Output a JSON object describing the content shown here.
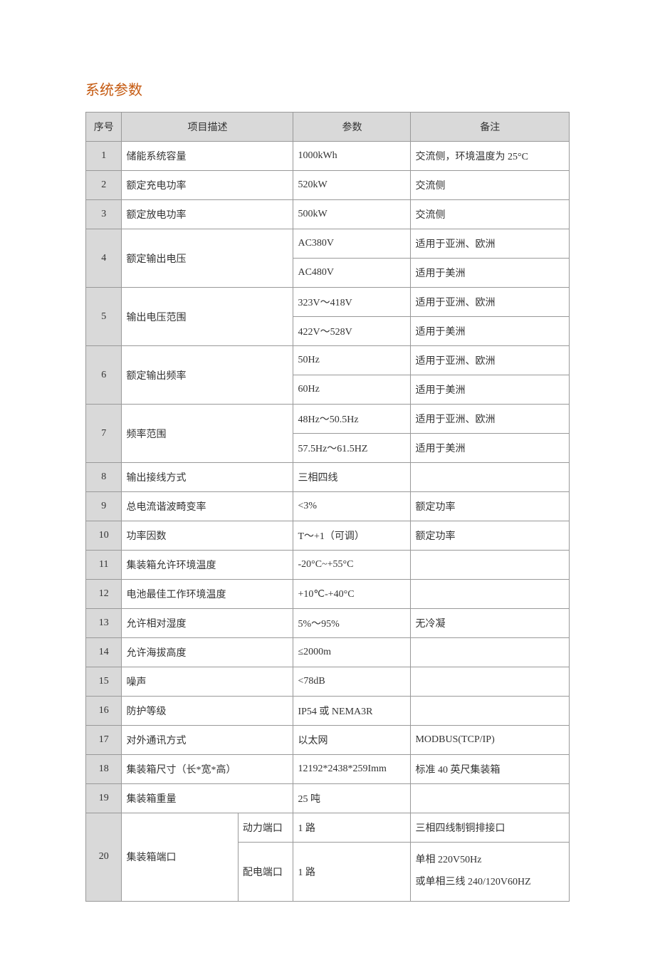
{
  "title": "系统参数",
  "headers": {
    "num": "序号",
    "desc": "项目描述",
    "param": "参数",
    "note": "备注"
  },
  "rows": {
    "r1": {
      "num": "1",
      "desc": "储能系统容量",
      "param": "1000kWh",
      "note": "交流侧，环境温度为 25°C"
    },
    "r2": {
      "num": "2",
      "desc": "额定充电功率",
      "param": "520kW",
      "note": "交流侧"
    },
    "r3": {
      "num": "3",
      "desc": "额定放电功率",
      "param": "500kW",
      "note": "交流侧"
    },
    "r4": {
      "num": "4",
      "desc": "额定输出电压",
      "sub1": {
        "param": "AC380V",
        "note": "适用于亚洲、欧洲"
      },
      "sub2": {
        "param": "AC480V",
        "note": "适用于美洲"
      }
    },
    "r5": {
      "num": "5",
      "desc": "输出电压范围",
      "sub1": {
        "param": "323V～418V",
        "note": "适用于亚洲、欧洲"
      },
      "sub2": {
        "param": "422V～528V",
        "note": "适用于美洲"
      }
    },
    "r6": {
      "num": "6",
      "desc": "额定输出频率",
      "sub1": {
        "param": "50Hz",
        "note": "适用于亚洲、欧洲"
      },
      "sub2": {
        "param": "60Hz",
        "note": "适用于美洲"
      }
    },
    "r7": {
      "num": "7",
      "desc": "频率范围",
      "sub1": {
        "param": "48Hz～50.5Hz",
        "note": "适用于亚洲、欧洲"
      },
      "sub2": {
        "param": "57.5Hz～61.5HZ",
        "note": "适用于美洲"
      }
    },
    "r8": {
      "num": "8",
      "desc": "输出接线方式",
      "param": "三相四线",
      "note": ""
    },
    "r9": {
      "num": "9",
      "desc": "总电流谐波畸变率",
      "param": "<3%",
      "note": "额定功率"
    },
    "r10": {
      "num": "10",
      "desc": "功率因数",
      "param": "T～+1（可调）",
      "note": "额定功率"
    },
    "r11": {
      "num": "11",
      "desc": "集装箱允许环境温度",
      "param": "-20°C~+55°C",
      "note": ""
    },
    "r12": {
      "num": "12",
      "desc": "电池最佳工作环境温度",
      "param": "+10℃-+40°C",
      "note": ""
    },
    "r13": {
      "num": "13",
      "desc": "允许相对湿度",
      "param": "5%～95%",
      "note": "无冷凝"
    },
    "r14": {
      "num": "14",
      "desc": "允许海拔高度",
      "param": "≤2000m",
      "note": ""
    },
    "r15": {
      "num": "15",
      "desc": "噪声",
      "param": "<78dB",
      "note": ""
    },
    "r16": {
      "num": "16",
      "desc": "防护等级",
      "param": "IP54 或 NEMA3R",
      "note": ""
    },
    "r17": {
      "num": "17",
      "desc": "对外通讯方式",
      "param": "以太网",
      "note": "MODBUS(TCP/IP)"
    },
    "r18": {
      "num": "18",
      "desc": "集装箱尺寸（长*宽*高）",
      "param": "12192*2438*259Imm",
      "note": "标准 40 英尺集装箱"
    },
    "r19": {
      "num": "19",
      "desc": "集装箱重量",
      "param": "25 吨",
      "note": ""
    },
    "r20": {
      "num": "20",
      "desc": "集装箱端口",
      "sub1": {
        "label": "动力端口",
        "param": "1 路",
        "note": "三相四线制铜排接口"
      },
      "sub2": {
        "label": "配电端口",
        "param": "1 路",
        "note_line1": "单相 220V50Hz",
        "note_line2": "或单相三线 240/120V60HZ"
      }
    }
  }
}
